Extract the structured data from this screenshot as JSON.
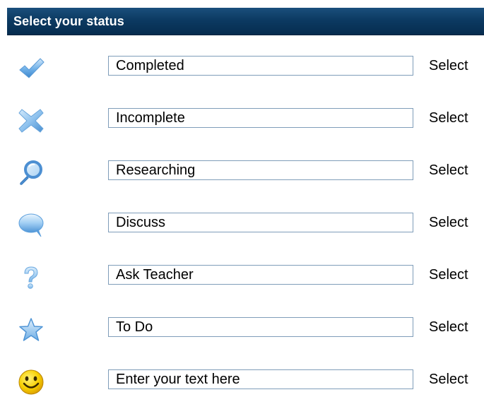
{
  "header": {
    "title": "Select your status"
  },
  "colors": {
    "header_bg": "#0c3a62",
    "icon_blue": "#4f95d6",
    "icon_light": "#bcdcf6",
    "smiley_yellow": "#f5c400",
    "input_border": "#7f9db9"
  },
  "statuses": [
    {
      "icon": "checkmark-icon",
      "value": "Completed",
      "action": "Select"
    },
    {
      "icon": "cross-icon",
      "value": "Incomplete",
      "action": "Select"
    },
    {
      "icon": "magnifier-icon",
      "value": "Researching",
      "action": "Select"
    },
    {
      "icon": "speech-bubble-icon",
      "value": "Discuss",
      "action": "Select"
    },
    {
      "icon": "question-mark-icon",
      "value": "Ask Teacher",
      "action": "Select"
    },
    {
      "icon": "star-icon",
      "value": "To Do",
      "action": "Select"
    },
    {
      "icon": "smiley-icon",
      "value": "Enter your text here",
      "action": "Select"
    }
  ]
}
